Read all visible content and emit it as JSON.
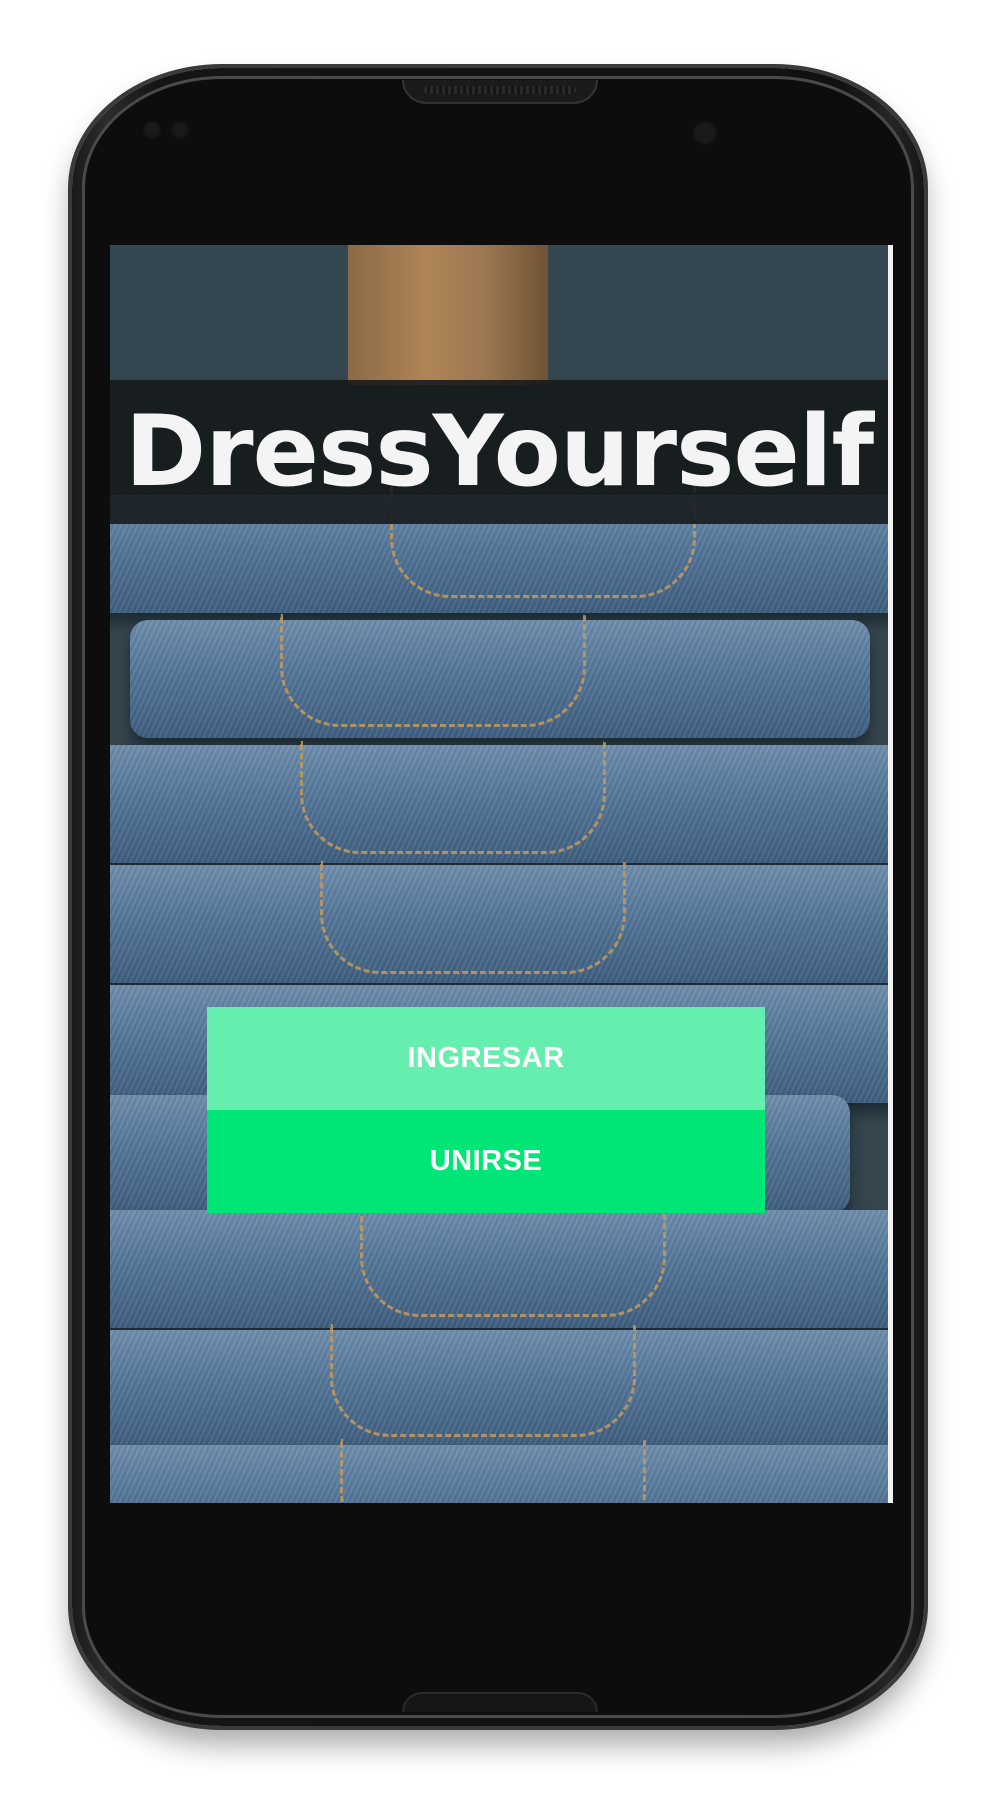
{
  "app": {
    "title": "DressYourself"
  },
  "actions": {
    "login_label": "INGRESAR",
    "join_label": "UNIRSE"
  },
  "colors": {
    "login_button": "#66eeae",
    "join_button": "#00e676",
    "title_band": "#14181a",
    "title_text": "#f4f4f4"
  },
  "background": {
    "image_subject": "stacked-denim-jeans"
  }
}
